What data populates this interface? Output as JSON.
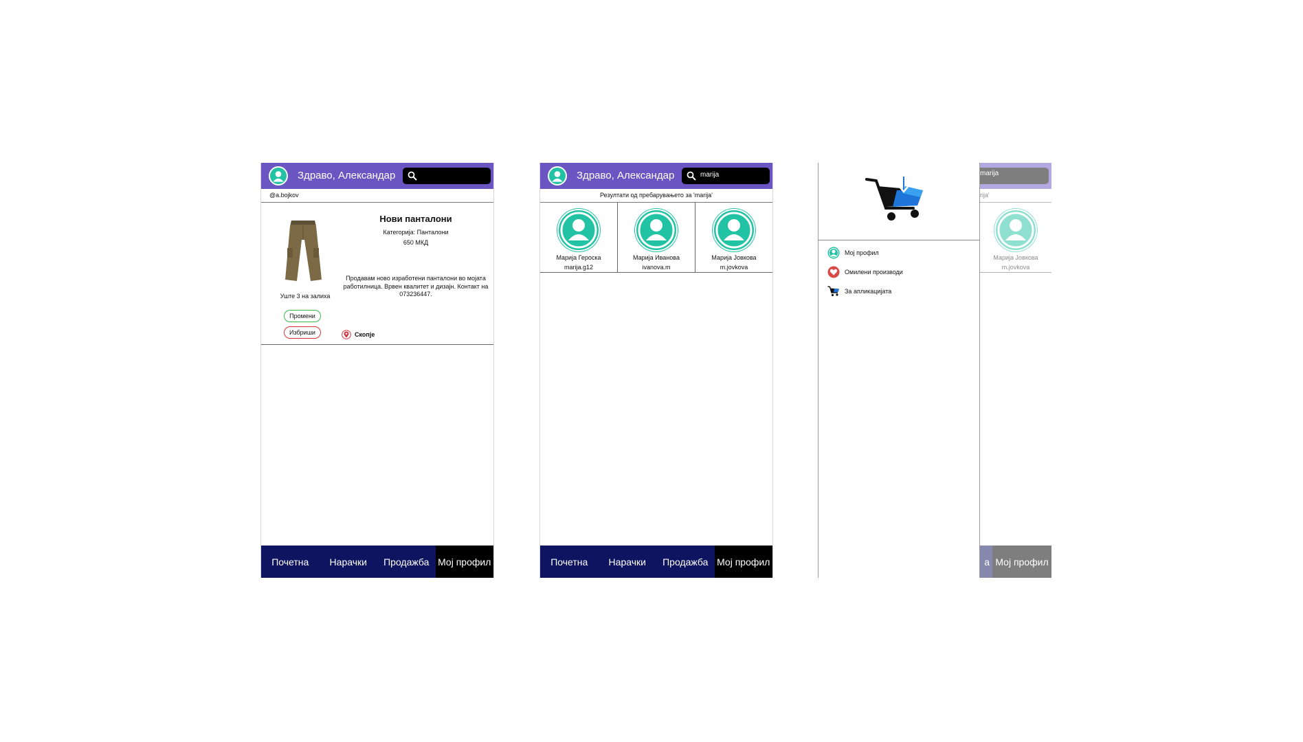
{
  "colors": {
    "header": "#6a55c2",
    "nav": "#0f1460",
    "nav_active": "#000000",
    "accent": "#22c3a4",
    "edit": "#33bb4b",
    "delete": "#d8323a"
  },
  "screen1": {
    "greeting": "Здраво, Александар",
    "search_value": "",
    "username": "@a.bojkov",
    "product": {
      "title": "Нови панталони",
      "category": "Категорија: Панталони",
      "price": "650 МКД",
      "description": "Продавам ново изработени панталони во мојата работилница. Врвен квалитет и дизајн. Контакт на 073236447.",
      "stock": "Уште 3 на залиха",
      "edit_label": "Промени",
      "delete_label": "Избриши",
      "location": "Скопје"
    },
    "nav": [
      "Почетна",
      "Нарачки",
      "Продажба",
      "Мој профил"
    ]
  },
  "screen2": {
    "greeting": "Здраво, Александар",
    "search_value": "marija",
    "results_label": "Резултати од пребарувањето за 'marija'",
    "results": [
      {
        "name": "Марија Героска",
        "user": "marija.g12"
      },
      {
        "name": "Марија Иванова",
        "user": "ivanova.m"
      },
      {
        "name": "Марија Јовкова",
        "user": "m.jovkova"
      }
    ],
    "nav": [
      "Почетна",
      "Нарачки",
      "Продажба",
      "Мој профил"
    ]
  },
  "screen3": {
    "search_value": "marija",
    "subbar_fragment": "rija'",
    "visible_name": "Марија Јовкова",
    "visible_user": "m.jovkova",
    "nav_fragment": "a",
    "nav_profile": "Мој профил",
    "menu": [
      {
        "label": "Мој профил",
        "icon": "user-icon"
      },
      {
        "label": "Омилени производи",
        "icon": "heart-icon"
      },
      {
        "label": "За апликацијата",
        "icon": "cart-icon"
      }
    ]
  }
}
